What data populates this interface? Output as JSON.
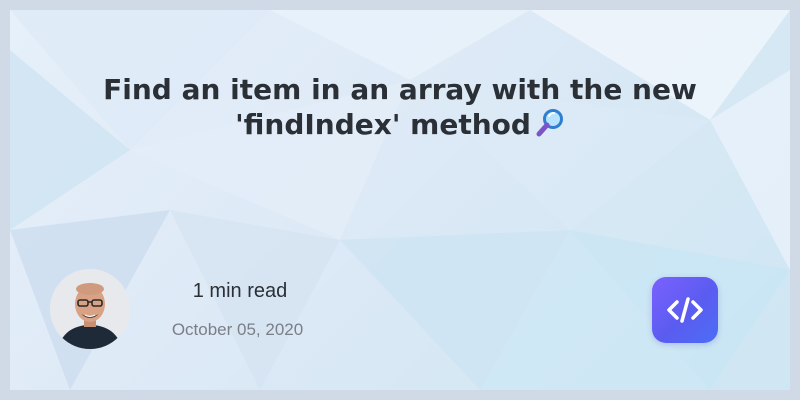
{
  "post": {
    "title_line1": "Find an item in an array with the new",
    "title_line2": "'findIndex' method",
    "title_emoji": "magnifying-glass-icon",
    "read_time": "1 min read",
    "date": "October 05, 2020"
  },
  "author": {
    "avatar": "author-avatar-photo"
  },
  "brand": {
    "logo_icon": "code-icon",
    "logo_color": "#6a5cff"
  },
  "colors": {
    "background": "#cfdae6",
    "title_text": "#2b2f36",
    "date_text": "#7a7f87"
  }
}
